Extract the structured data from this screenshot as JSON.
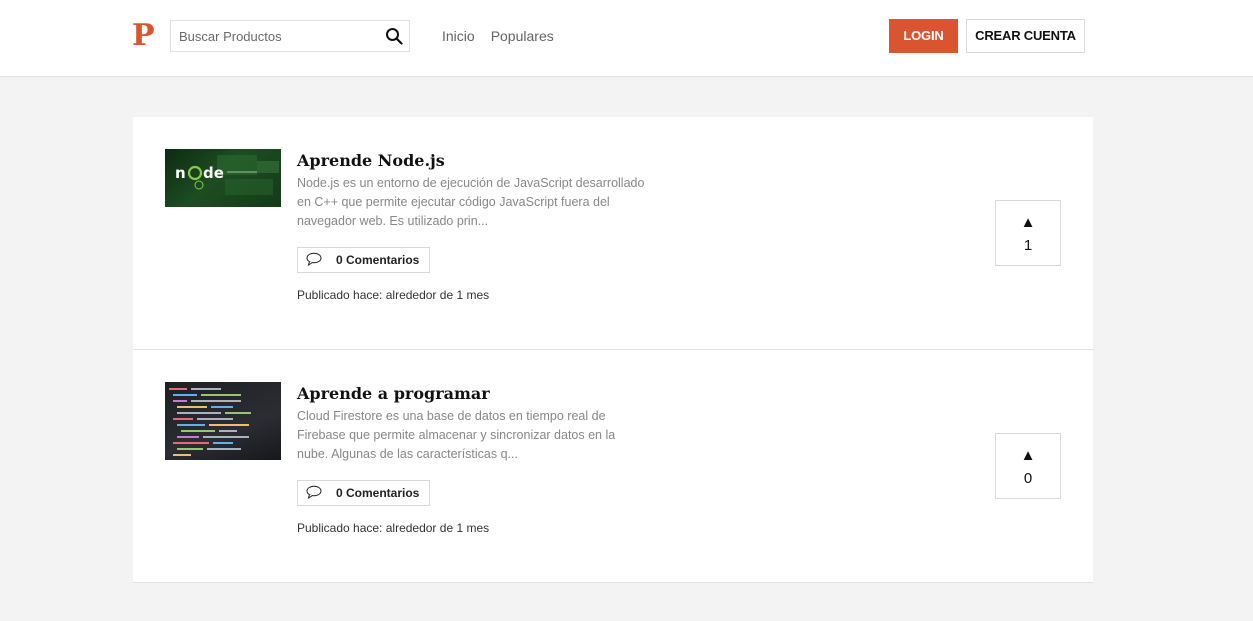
{
  "header": {
    "logo": "P",
    "search": {
      "placeholder": "Buscar Productos"
    },
    "nav": [
      "Inicio",
      "Populares"
    ],
    "login_label": "LOGIN",
    "create_account_label": "CREAR CUENTA"
  },
  "products": [
    {
      "title": "Aprende Node.js",
      "description": "Node.js es un entorno de ejecución de JavaScript desarrollado en C++ que permite ejecutar código JavaScript fuera del navegador web. Es utilizado prin...",
      "comments_label": "0 Comentarios",
      "published": "Publicado hace: alrededor de 1 mes",
      "votes": "1",
      "image_icon": "node-js-logo-image"
    },
    {
      "title": "Aprende a programar",
      "description": "Cloud Firestore es una base de datos en tiempo real de Firebase que permite almacenar y sincronizar datos en la nube. Algunas de las características q...",
      "comments_label": "0 Comentarios",
      "published": "Publicado hace: alrededor de 1 mes",
      "votes": "0",
      "image_icon": "code-screen-image"
    }
  ],
  "colors": {
    "accent": "#da552f",
    "background": "#f3f3f3"
  }
}
